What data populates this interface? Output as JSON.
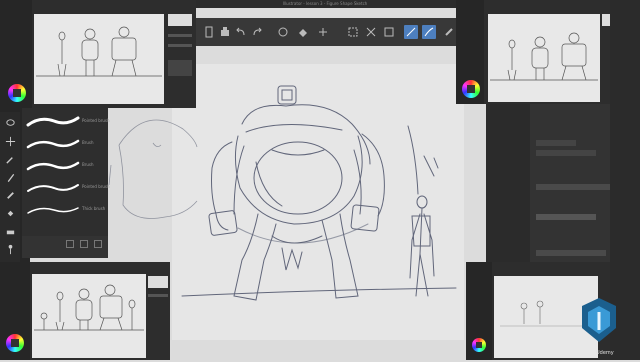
{
  "window": {
    "title": "Illustrator - lesson 3 - Figure Shape Sketch"
  },
  "command_bar": {
    "icons": [
      "new-file-icon",
      "save-icon",
      "undo-icon",
      "redo-icon",
      "clear-icon",
      "fill-icon",
      "transform-icon",
      "select-all-icon",
      "deselect-icon",
      "invert-icon",
      "pen-stroke-icon",
      "erase-stroke-icon",
      "brush-icon"
    ],
    "selected": [
      "pen-stroke-icon",
      "erase-stroke-icon"
    ]
  },
  "tools": [
    "lasso-icon",
    "move-icon",
    "eyedropper-icon",
    "pen-icon",
    "pencil-icon",
    "fill-bucket-icon",
    "eraser-icon",
    "figure-icon"
  ],
  "brush_panel": {
    "brushes": [
      {
        "name": "Pointed brush"
      },
      {
        "name": "Brush"
      },
      {
        "name": "Brush"
      },
      {
        "name": "Pointed brush"
      },
      {
        "name": "Thick brush"
      }
    ],
    "footer_icons": [
      "add-brush-icon",
      "duplicate-icon",
      "delete-icon"
    ]
  },
  "logo": {
    "text": "Udemy"
  },
  "colors": {
    "accent": "#4d7fbf",
    "panel": "#2e2e2e",
    "canvas": "#e6e6e6",
    "stroke": "#4a5068"
  }
}
